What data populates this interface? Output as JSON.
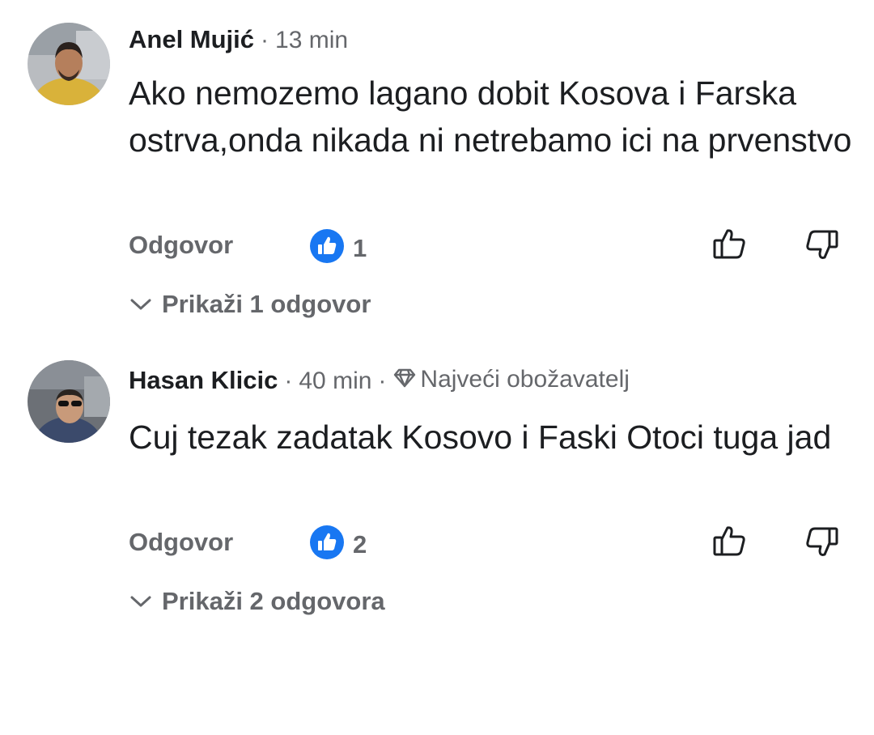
{
  "comments": [
    {
      "author": "Anel Mujić",
      "separator": "·",
      "time": "13 min",
      "badge": "",
      "text": "Ako nemozemo lagano dobit Kosova i Farska ostrva,onda nikada ni netrebamo ici na prvenstvo",
      "reply_label": "Odgovor",
      "reaction_count": "1",
      "show_replies_label": "Prikaži 1 odgovor"
    },
    {
      "author": "Hasan Klicic",
      "separator": "·",
      "time": "40 min",
      "separator2": "·",
      "badge": "Najveći obožavatelj",
      "text": "Cuj tezak zadatak Kosovo i Faski Otoci tuga jad",
      "reply_label": "Odgovor",
      "reaction_count": "2",
      "show_replies_label": "Prikaži 2 odgovora"
    }
  ],
  "icons": {
    "like_reaction": "like-reaction-icon",
    "thumbs_up": "thumbs-up-icon",
    "thumbs_down": "thumbs-down-icon",
    "chevron": "chevron-down-icon",
    "diamond": "diamond-icon"
  },
  "colors": {
    "like_blue": "#1877f2",
    "secondary_text": "#65676b",
    "primary_text": "#1c1e21"
  }
}
